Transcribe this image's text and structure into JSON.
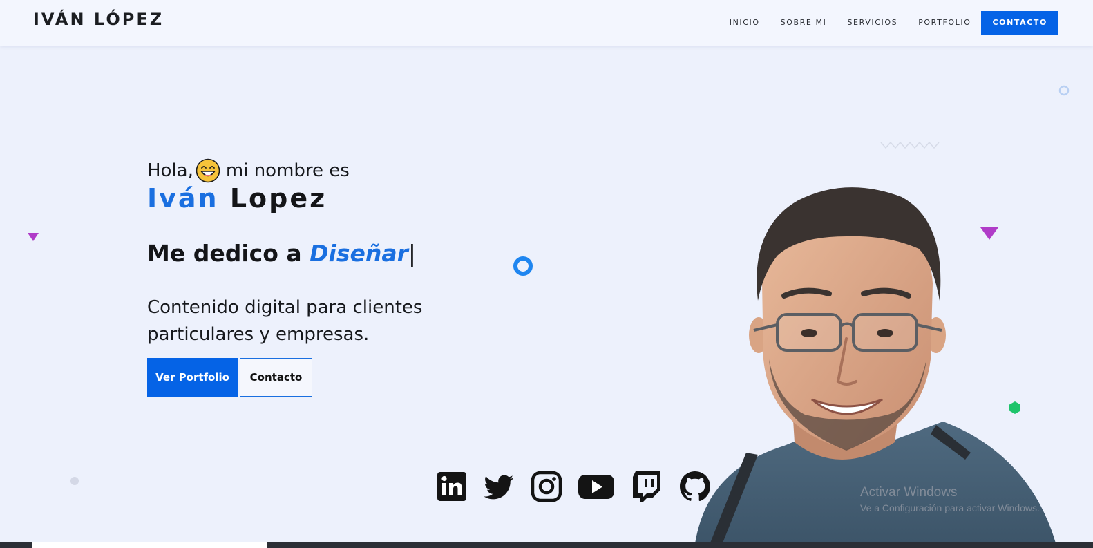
{
  "navbar": {
    "brand": "IVÁN LÓPEZ",
    "links": [
      {
        "label": "INICIO"
      },
      {
        "label": "SOBRE MI"
      },
      {
        "label": "SERVICIOS"
      },
      {
        "label": "PORTFOLIO"
      }
    ],
    "cta_label": "CONTACTO"
  },
  "hero": {
    "greeting_pre": "Hola,",
    "greeting_emoji": "grinning-face-icon",
    "greeting_post": "mi nombre es",
    "first_name": "Iván",
    "last_name": "Lopez",
    "tagline_prefix": "Me dedico a",
    "tagline_role": "Diseñar",
    "tagline_cursor": "|",
    "description": "Contenido digital para clientes particulares y empresas.",
    "primary_button": "Ver Portfolio",
    "secondary_button": "Contacto"
  },
  "social": [
    {
      "icon": "linkedin-icon"
    },
    {
      "icon": "twitter-icon"
    },
    {
      "icon": "instagram-icon"
    },
    {
      "icon": "youtube-icon"
    },
    {
      "icon": "twitch-icon"
    },
    {
      "icon": "github-icon"
    }
  ],
  "watermark": {
    "title": "Activar Windows",
    "subtitle": "Ve a Configuración para activar Windows."
  },
  "colors": {
    "accent": "#0563e6",
    "name_blue": "#1a6fe0",
    "background": "#edf1fc",
    "navbar_bg": "#f3f6fe",
    "text_dark": "#141518",
    "deco_purple": "#b03cc8",
    "deco_green": "#1ec46b"
  }
}
